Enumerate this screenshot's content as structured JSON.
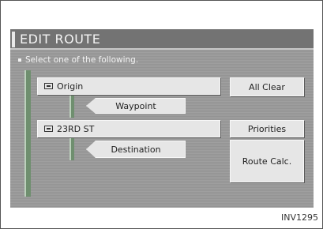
{
  "title": "EDIT ROUTE",
  "instruction": "Select one of the following.",
  "route": {
    "origin_label": "Origin",
    "waypoint_label": "Waypoint",
    "street_label": "23RD ST",
    "destination_label": "Destination"
  },
  "actions": {
    "all_clear": "All Clear",
    "priorities": "Priorities",
    "route_calc": "Route Calc."
  },
  "figure_code": "INV1295"
}
